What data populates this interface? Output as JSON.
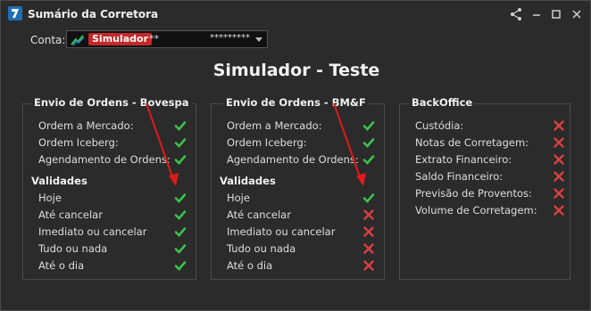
{
  "window": {
    "title": "Sumário da Corretora"
  },
  "account": {
    "label": "Conta:",
    "badge": "Simulador",
    "masked_id": "**",
    "masked_suffix": "*********"
  },
  "heading": "Simulador - Teste",
  "colors": {
    "ok": "#3cc24a",
    "fail": "#d84040",
    "arrow": "#e01a1a",
    "badge": "#c62828"
  },
  "panels": [
    {
      "title": "Envio de Ordens - Bovespa",
      "items": [
        {
          "label": "Ordem a Mercado:",
          "ok": true
        },
        {
          "label": "Ordem Iceberg:",
          "ok": true
        },
        {
          "label": "Agendamento de Ordens:",
          "ok": true
        }
      ],
      "validades_title": "Validades",
      "validades": [
        {
          "label": "Hoje",
          "ok": true
        },
        {
          "label": "Até cancelar",
          "ok": true
        },
        {
          "label": "Imediato ou cancelar",
          "ok": true
        },
        {
          "label": "Tudo ou nada",
          "ok": true
        },
        {
          "label": "Até o dia",
          "ok": true
        }
      ]
    },
    {
      "title": "Envio de Ordens - BM&F",
      "items": [
        {
          "label": "Ordem a Mercado:",
          "ok": true
        },
        {
          "label": "Ordem Iceberg:",
          "ok": true
        },
        {
          "label": "Agendamento de Ordens:",
          "ok": true
        }
      ],
      "validades_title": "Validades",
      "validades": [
        {
          "label": "Hoje",
          "ok": true
        },
        {
          "label": "Até cancelar",
          "ok": false
        },
        {
          "label": "Imediato ou cancelar",
          "ok": false
        },
        {
          "label": "Tudo ou nada",
          "ok": false
        },
        {
          "label": "Até o dia",
          "ok": false
        }
      ]
    },
    {
      "title": "BackOffice",
      "items": [
        {
          "label": "Custódia:",
          "ok": false
        },
        {
          "label": "Notas de Corretagem:",
          "ok": false
        },
        {
          "label": "Extrato Financeiro:",
          "ok": false
        },
        {
          "label": "Saldo Financeiro:",
          "ok": false
        },
        {
          "label": "Previsão de Proventos:",
          "ok": false
        },
        {
          "label": "Volume de Corretagem:",
          "ok": false
        }
      ]
    }
  ]
}
